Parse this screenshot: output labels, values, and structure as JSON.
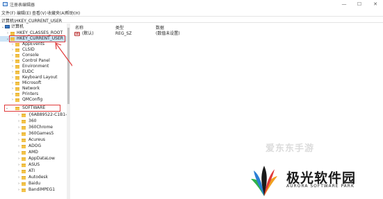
{
  "window": {
    "title": "注册表编辑器",
    "minimize_glyph": "—",
    "maximize_glyph": "☐",
    "close_glyph": "✕"
  },
  "menu": [
    "文件(F)",
    "编辑(E)",
    "查看(V)",
    "收藏夹(A)",
    "帮助(H)"
  ],
  "address": "计算机\\HKEY_CURRENT_USER",
  "tree": {
    "root": "计算机",
    "top_keys": [
      "HKEY_CLASSES_ROOT",
      "HKEY_CURRENT_USER"
    ],
    "hkcu_children": [
      "AppEvents",
      "CLSID",
      "Console",
      "Control Panel",
      "Environment",
      "EUDC",
      "Keyboard Layout",
      "Microsoft",
      "Network",
      "Printers",
      "QMConfig",
      "SOFTWARE"
    ],
    "software_children": [
      "{6AB89522-C1B1-4",
      "360",
      "360Chrome",
      "360Games5",
      "Acureus",
      "ADOG",
      "AMD",
      "AppDataLow",
      "ASUS",
      "ATI",
      "Autodesk",
      "Baidu",
      "BandiMPEG1"
    ]
  },
  "list": {
    "columns": [
      "名称",
      "类型",
      "数据"
    ],
    "rows": [
      {
        "name": "(默认)",
        "type": "REG_SZ",
        "data": "(数值未设置)"
      }
    ]
  },
  "watermark": {
    "top_text": "爱东东手游",
    "brand_title": "极光软件园",
    "brand_sub": "AURORA SOFTWARE PARK"
  },
  "colors": {
    "annotation_red": "#e03a3a",
    "selection": "#cce4f7",
    "folder": "#f3c34a"
  }
}
